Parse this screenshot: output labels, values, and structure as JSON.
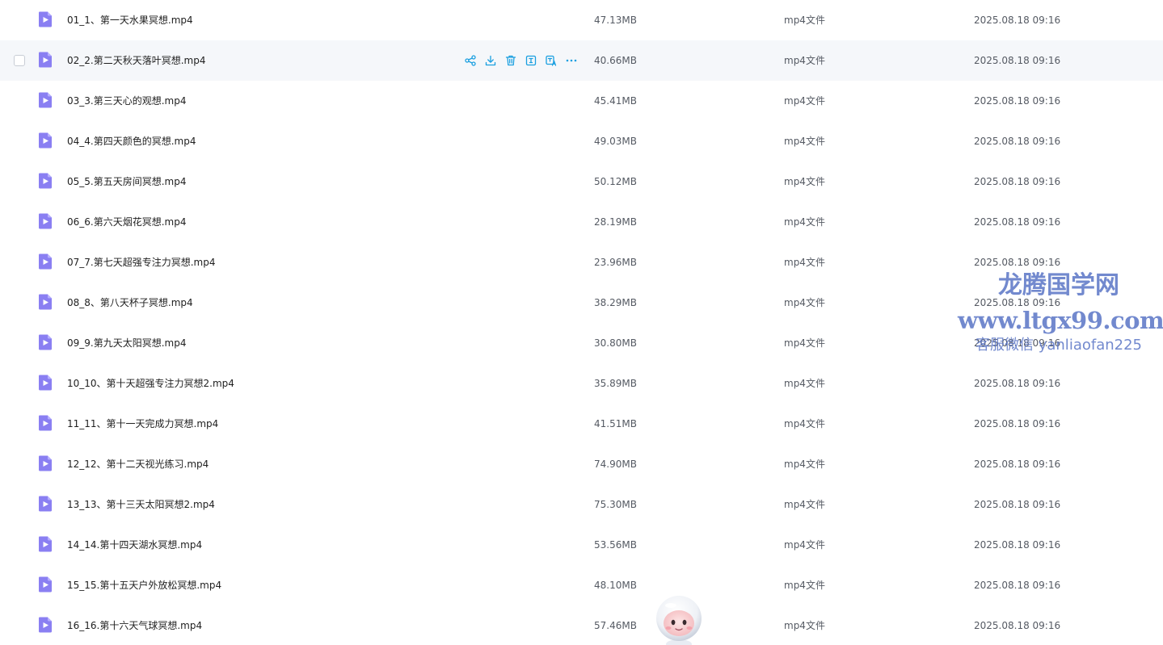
{
  "colors": {
    "accent": "#1a9fe0",
    "file_icon": "#8a7ff2",
    "hover_row": "#f5f7fa",
    "watermark": "#5a75c6"
  },
  "row_actions": [
    {
      "name": "share-icon"
    },
    {
      "name": "download-icon"
    },
    {
      "name": "delete-icon"
    },
    {
      "name": "rename-icon"
    },
    {
      "name": "translate-icon"
    },
    {
      "name": "more-icon"
    }
  ],
  "files": [
    {
      "name": "01_1、第一天水果冥想.mp4",
      "size": "47.13MB",
      "type": "mp4文件",
      "date": "2025.08.18 09:16",
      "icon": "video-file-icon",
      "hovered": false
    },
    {
      "name": "02_2.第二天秋天落叶冥想.mp4",
      "size": "40.66MB",
      "type": "mp4文件",
      "date": "2025.08.18 09:16",
      "icon": "video-file-icon",
      "hovered": true
    },
    {
      "name": "03_3.第三天心的观想.mp4",
      "size": "45.41MB",
      "type": "mp4文件",
      "date": "2025.08.18 09:16",
      "icon": "video-file-icon",
      "hovered": false
    },
    {
      "name": "04_4.第四天颜色的冥想.mp4",
      "size": "49.03MB",
      "type": "mp4文件",
      "date": "2025.08.18 09:16",
      "icon": "video-file-icon",
      "hovered": false
    },
    {
      "name": "05_5.第五天房间冥想.mp4",
      "size": "50.12MB",
      "type": "mp4文件",
      "date": "2025.08.18 09:16",
      "icon": "video-file-icon",
      "hovered": false
    },
    {
      "name": "06_6.第六天烟花冥想.mp4",
      "size": "28.19MB",
      "type": "mp4文件",
      "date": "2025.08.18 09:16",
      "icon": "video-file-icon",
      "hovered": false
    },
    {
      "name": "07_7.第七天超强专注力冥想.mp4",
      "size": "23.96MB",
      "type": "mp4文件",
      "date": "2025.08.18 09:16",
      "icon": "video-file-icon",
      "hovered": false
    },
    {
      "name": "08_8、第八天杯子冥想.mp4",
      "size": "38.29MB",
      "type": "mp4文件",
      "date": "2025.08.18 09:16",
      "icon": "video-file-icon",
      "hovered": false
    },
    {
      "name": "09_9.第九天太阳冥想.mp4",
      "size": "30.80MB",
      "type": "mp4文件",
      "date": "2025.08.18 09:16",
      "icon": "video-file-icon",
      "hovered": false
    },
    {
      "name": "10_10、第十天超强专注力冥想2.mp4",
      "size": "35.89MB",
      "type": "mp4文件",
      "date": "2025.08.18 09:16",
      "icon": "video-file-icon",
      "hovered": false
    },
    {
      "name": "11_11、第十一天完成力冥想.mp4",
      "size": "41.51MB",
      "type": "mp4文件",
      "date": "2025.08.18 09:16",
      "icon": "video-file-icon",
      "hovered": false
    },
    {
      "name": "12_12、第十二天视光练习.mp4",
      "size": "74.90MB",
      "type": "mp4文件",
      "date": "2025.08.18 09:16",
      "icon": "video-file-icon",
      "hovered": false
    },
    {
      "name": "13_13、第十三天太阳冥想2.mp4",
      "size": "75.30MB",
      "type": "mp4文件",
      "date": "2025.08.18 09:16",
      "icon": "video-file-icon",
      "hovered": false
    },
    {
      "name": "14_14.第十四天湖水冥想.mp4",
      "size": "53.56MB",
      "type": "mp4文件",
      "date": "2025.08.18 09:16",
      "icon": "video-file-icon",
      "hovered": false
    },
    {
      "name": "15_15.第十五天户外放松冥想.mp4",
      "size": "48.10MB",
      "type": "mp4文件",
      "date": "2025.08.18 09:16",
      "icon": "video-file-icon",
      "hovered": false
    },
    {
      "name": "16_16.第十六天气球冥想.mp4",
      "size": "57.46MB",
      "type": "mp4文件",
      "date": "2025.08.18 09:16",
      "icon": "video-file-icon",
      "hovered": false
    }
  ],
  "watermark": {
    "title": "龙腾国学网",
    "url": "www.ltgx99.com",
    "contact": "客服微信 yanliaofan225"
  },
  "assistant": {
    "icon": "assistant-mascot-icon"
  }
}
